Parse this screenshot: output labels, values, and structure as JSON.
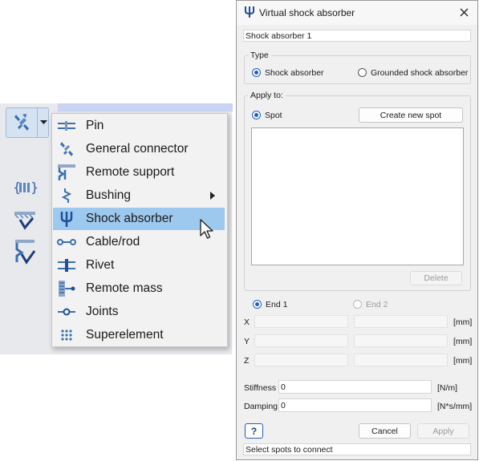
{
  "toolbar": {
    "icons": [
      "connector-icon",
      "chevron-down-icon",
      "superelement-brace-icon",
      "support-icon",
      "remote-support-icon"
    ]
  },
  "menu": {
    "items": [
      {
        "label": "Pin",
        "icon": "pin-icon"
      },
      {
        "label": "General connector",
        "icon": "general-connector-icon"
      },
      {
        "label": "Remote support",
        "icon": "remote-support-icon"
      },
      {
        "label": "Bushing",
        "icon": "bushing-icon",
        "has_submenu": true
      },
      {
        "label": "Shock absorber",
        "icon": "shock-absorber-icon",
        "selected": true
      },
      {
        "label": "Cable/rod",
        "icon": "cable-rod-icon"
      },
      {
        "label": "Rivet",
        "icon": "rivet-icon"
      },
      {
        "label": "Remote mass",
        "icon": "remote-mass-icon"
      },
      {
        "label": "Joints",
        "icon": "joints-icon"
      },
      {
        "label": "Superelement",
        "icon": "superelement-icon"
      }
    ]
  },
  "dialog": {
    "title": "Virtual shock absorber",
    "name_value": "Shock absorber 1",
    "type": {
      "legend": "Type",
      "options": [
        "Shock absorber",
        "Grounded shock absorber"
      ],
      "selected": "Shock absorber"
    },
    "apply_to": {
      "legend": "Apply to:",
      "option": "Spot",
      "create_button": "Create new spot",
      "delete_button": "Delete"
    },
    "ends": {
      "options": [
        "End 1",
        "End 2"
      ],
      "selected": "End 1"
    },
    "coords": [
      {
        "axis": "X",
        "unit": "[mm]"
      },
      {
        "axis": "Y",
        "unit": "[mm]"
      },
      {
        "axis": "Z",
        "unit": "[mm]"
      }
    ],
    "stiffness": {
      "label": "Stiffness",
      "value": "0",
      "unit": "[N/m]"
    },
    "damping": {
      "label": "Damping",
      "value": "0",
      "unit": "[N*s/mm]"
    },
    "help_label": "?",
    "cancel_label": "Cancel",
    "apply_label": "Apply",
    "status": "Select spots to connect"
  },
  "colors": {
    "accent": "#1f5fbf",
    "menu_selected": "#9ec9ef",
    "icon_blue": "#3a6fb0"
  }
}
